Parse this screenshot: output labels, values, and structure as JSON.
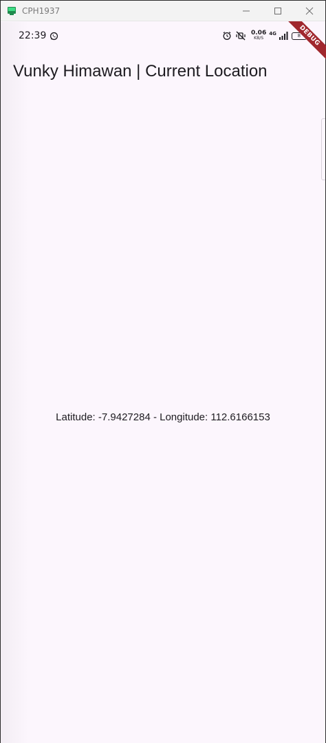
{
  "window": {
    "title": "CPH1937"
  },
  "status_bar": {
    "time": "22:39",
    "net_speed": "0.06",
    "net_speed_unit": "KB/S",
    "network_type": "4G",
    "battery": "8",
    "icons": [
      "whatsapp-icon",
      "alarm-icon",
      "mute-vibrate-icon",
      "signal-icon",
      "battery-icon"
    ]
  },
  "app_bar": {
    "title": "Vunky Himawan | Current Location"
  },
  "body": {
    "location_text": "Latitude: -7.9427284 - Longitude: 112.6166153"
  },
  "debug_banner": {
    "label": "DEBUG",
    "color": "#a0282e"
  },
  "colors": {
    "background": "#fcf6fd",
    "text": "#1d1b20",
    "titlebar": "#f3f3f3"
  }
}
